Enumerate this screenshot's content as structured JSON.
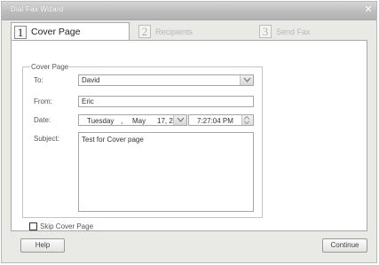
{
  "window": {
    "title": "Dial Fax Wizard"
  },
  "tabs": [
    {
      "number": "1",
      "label": "Cover Page",
      "state": "active"
    },
    {
      "number": "2",
      "label": "Recipients",
      "state": "disabled"
    },
    {
      "number": "3",
      "label": "Send Fax",
      "state": "disabled"
    }
  ],
  "cover_page": {
    "group_label": "Cover Page",
    "to": {
      "label": "To:",
      "value": "David"
    },
    "from": {
      "label": "From:",
      "value": "Eric"
    },
    "date": {
      "label": "Date:",
      "weekday": "Tuesday",
      "separator": ",",
      "month": "May",
      "day": "17, 2",
      "time": "7:27:04 PM"
    },
    "subject": {
      "label": "Subject:",
      "value": "Test for Cover page"
    }
  },
  "skip_cover_page": {
    "label": "Skip Cover Page",
    "checked": false
  },
  "buttons": {
    "help": "Help",
    "continue": "Continue"
  },
  "icons": {
    "close": "close-icon",
    "dropdown": "chevron-down-icon",
    "spinner": "spinner-arrows-icon"
  }
}
